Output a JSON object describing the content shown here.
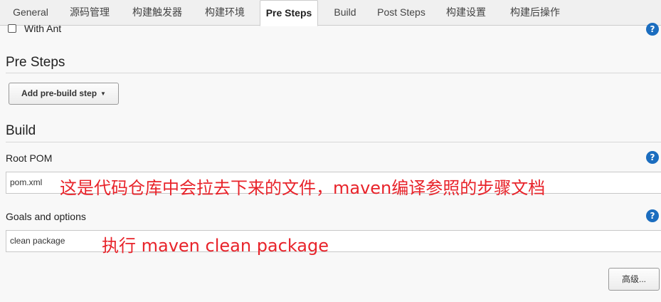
{
  "tabs": [
    {
      "label": "General",
      "active": false
    },
    {
      "label": "源码管理",
      "active": false
    },
    {
      "label": "构建触发器",
      "active": false
    },
    {
      "label": "构建环境",
      "active": false
    },
    {
      "label": "Pre Steps",
      "active": true
    },
    {
      "label": "Build",
      "active": false
    },
    {
      "label": "Post Steps",
      "active": false
    },
    {
      "label": "构建设置",
      "active": false
    },
    {
      "label": "构建后操作",
      "active": false
    }
  ],
  "build_env": {
    "with_ant_label": "With Ant",
    "with_ant_checked": false
  },
  "help_icon_glyph": "?",
  "pre_steps": {
    "title": "Pre Steps",
    "add_button_label": "Add pre-build step",
    "caret": "▼"
  },
  "build": {
    "title": "Build",
    "root_pom": {
      "label": "Root POM",
      "value": "pom.xml"
    },
    "goals": {
      "label": "Goals and options",
      "value": "clean package"
    },
    "advanced_label": "高级..."
  },
  "annotations": {
    "root_pom_note": "这是代码仓库中会拉去下来的文件，maven编译参照的步骤文档",
    "goals_note": "执行 maven clean package"
  },
  "colors": {
    "annotation": "#e8232a",
    "help_icon": "#1b6dbf"
  }
}
